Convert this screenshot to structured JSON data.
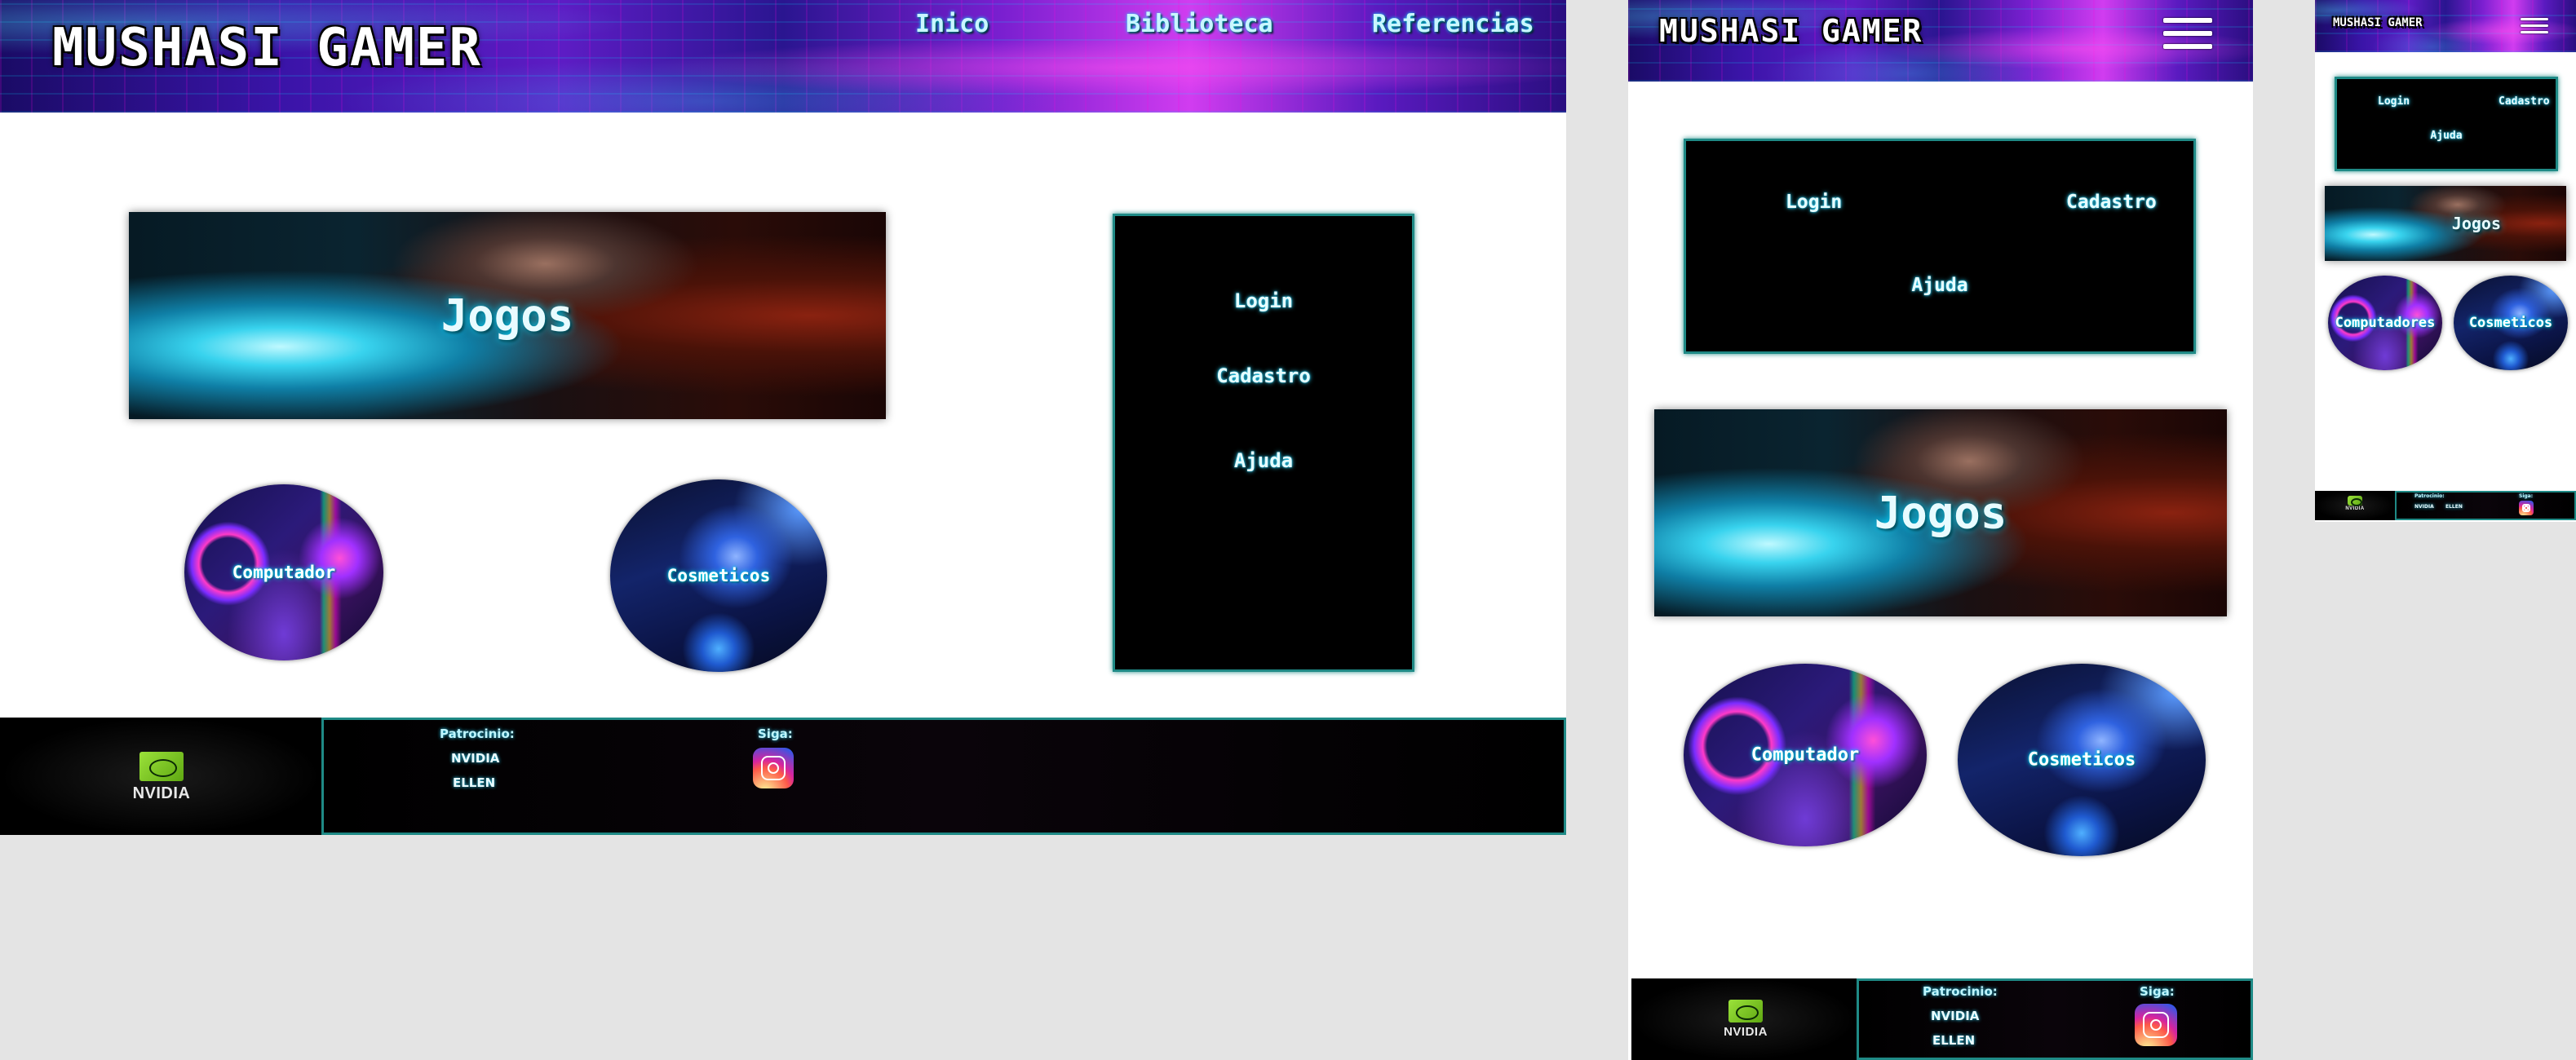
{
  "brand": "MUSHASI GAMER",
  "nav": {
    "home": "Inico",
    "library": "Biblioteca",
    "references": "Referencias"
  },
  "menu": {
    "login": "Login",
    "signup": "Cadastro",
    "help": "Ajuda"
  },
  "banner": {
    "title": "Jogos"
  },
  "categories": {
    "computer": "Computador",
    "computer_mobile": "Computadores",
    "cosmetics": "Cosmeticos"
  },
  "footer": {
    "sponsorship_title": "Patrocinio:",
    "sponsors": [
      "NVIDIA",
      "ELLEN"
    ],
    "follow_title": "Siga:",
    "nvidia_logo_text": "NVIDIA"
  },
  "icons": {
    "menu": "hamburger-menu-icon",
    "social": "instagram-icon",
    "sponsor": "nvidia-logo"
  },
  "colors": {
    "accent_border": "#1f8a86",
    "glow": "#2fd8ff",
    "background": "#e4e4e4"
  }
}
